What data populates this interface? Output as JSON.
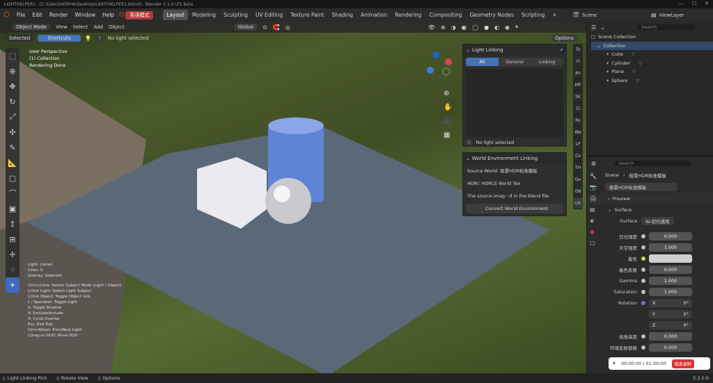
{
  "window": {
    "title": "LIGHTHELPER1 - [C:\\Users\\HORHA\\Desktop\\LIGHTHELPER1.blend] - Blender 5.1.0 LTS Beta"
  },
  "menu": {
    "items": [
      "File",
      "Edit",
      "Render",
      "Window",
      "Help"
    ],
    "lang_button": "英语模式",
    "workspaces": [
      "Layout",
      "Modeling",
      "Sculpting",
      "UV Editing",
      "Texture Paint",
      "Shading",
      "Animation",
      "Rendering",
      "Compositing",
      "Geometry Nodes",
      "Scripting"
    ],
    "active_workspace": "Layout",
    "scene": "Scene",
    "view_layer": "ViewLayer"
  },
  "viewport_header": {
    "mode": "Object Mode",
    "menus": [
      "View",
      "Select",
      "Add",
      "Object"
    ],
    "transform": "Global",
    "options": "Options"
  },
  "viewport_header2": {
    "selected": "Selected",
    "shortcuts": "Shortcuts",
    "no_light": "No light selected"
  },
  "viewport_overlay": {
    "line1": "User Perspective",
    "line2": "(1) Collection",
    "line3": "Rendering Done"
  },
  "hints": [
    "Light: (none)",
    "Links: 0",
    "Overlay: Selected",
    "",
    "Ctrl+LClick: Switch Subject Mode (Light / Object)",
    "LClick Light: Switch Light Subject",
    "LClick Object: Toggle Object Link",
    "L / Spacebar: Toggle Light",
    "S: Toggle Shadow",
    "A: Exclude/Include",
    "X: Cycle Overlay",
    "Esc: Exit Tool",
    "Ctrl+Wheel: Prev/Next Light",
    "LDrag on HUD: Move HUD"
  ],
  "light_linking": {
    "title": "Light Linking",
    "tabs": [
      "All",
      "General",
      "Linking"
    ],
    "active_tab": "All",
    "status": "No light selected"
  },
  "world_env": {
    "title": "World Environment Linking",
    "source": "Source World: 极景HDR标准模板",
    "hdri": "HDRI: HDRLS World Tex",
    "note": "The source imag···d in the blend file",
    "button": "Convert World Environment"
  },
  "side_tabs": [
    "To",
    "Vi",
    "An",
    "MP",
    "SK",
    "Cl",
    "Ro",
    "We",
    "LP",
    "Co",
    "TH",
    "Ge",
    "GN",
    "LH"
  ],
  "outliner": {
    "search_placeholder": "Search",
    "scene_collection": "Scene Collection",
    "collection": "Collection",
    "objects": [
      "Cube",
      "Cylinder",
      "Plane",
      "Sphere"
    ]
  },
  "properties": {
    "search_placeholder": "Search",
    "breadcrumb_scene": "Scene",
    "breadcrumb_world": "极景HDR标准模板",
    "world_name": "极景HDR标准模板",
    "preview": "Preview",
    "surface_header": "Surface",
    "surface_label": "Surface",
    "surface_value": "W-初代通用",
    "rows": [
      {
        "label": "日光强度",
        "value": "0.000"
      },
      {
        "label": "天空强度",
        "value": "1.000"
      },
      {
        "label": "着色",
        "value": ""
      },
      {
        "label": "着色系数",
        "value": "0.000"
      },
      {
        "label": "Gamma",
        "value": "1.000"
      },
      {
        "label": "Saturation",
        "value": "1.000"
      }
    ],
    "rotation_label": "Rotation",
    "rotation": [
      {
        "axis": "X",
        "value": "0°"
      },
      {
        "axis": "Y",
        "value": "0°"
      },
      {
        "axis": "Z",
        "value": "0°"
      }
    ],
    "rows2": [
      {
        "label": "视角高度",
        "value": "0.000"
      },
      {
        "label": "环境反射替换",
        "value": "0.000"
      }
    ]
  },
  "recorder": {
    "time": "00:00:00 / 01:00:00",
    "button": "结束录制"
  },
  "statusbar": {
    "items": [
      "Light Linking Pick",
      "Rotate View",
      "Options"
    ],
    "version": "5.2.0 b"
  },
  "colors": {
    "accent": "#4772b3",
    "record_red": "#d93636",
    "lang_red": "#b83838"
  }
}
